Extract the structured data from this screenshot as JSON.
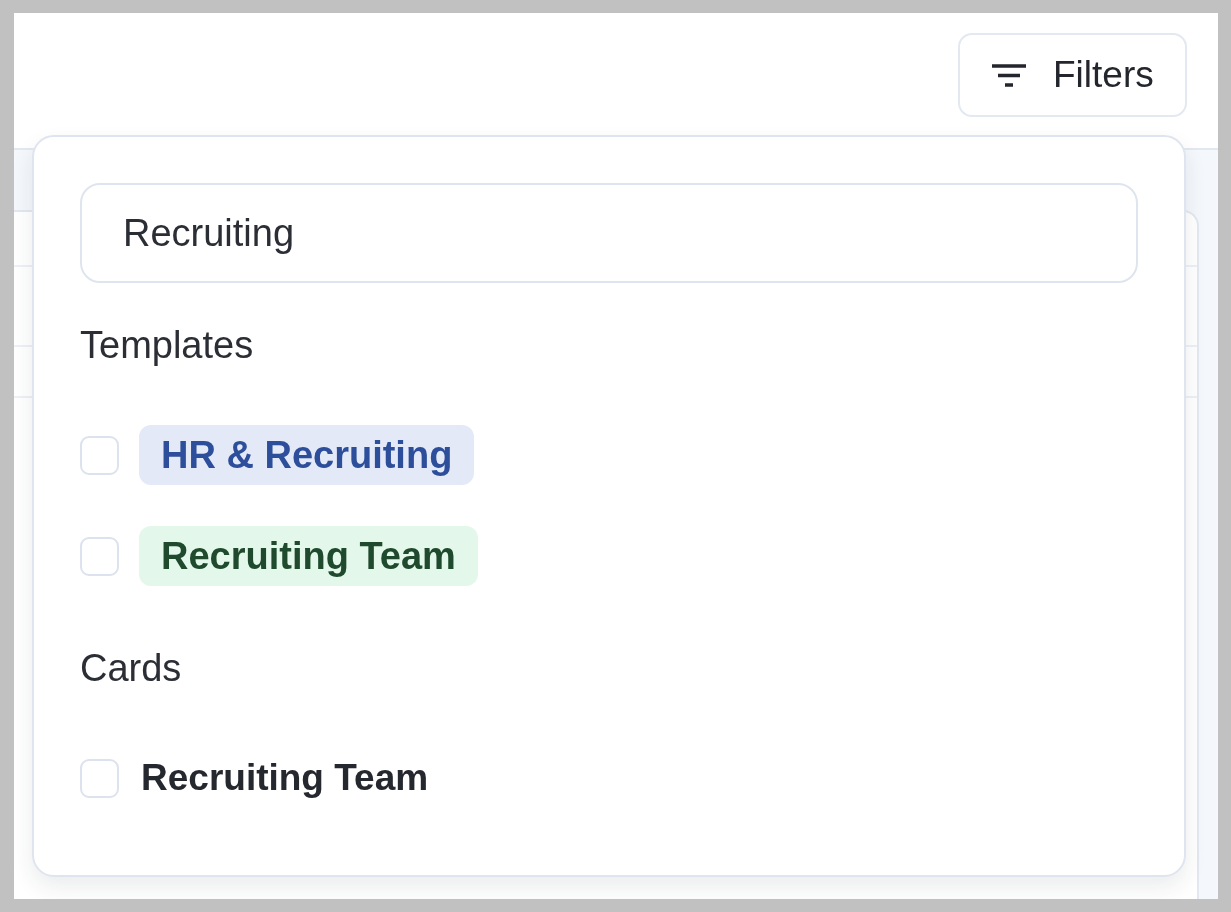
{
  "header": {
    "filters_button": {
      "label": "Filters"
    }
  },
  "filter_popover": {
    "search": {
      "value": "Recruiting"
    },
    "sections": [
      {
        "title": "Templates",
        "items": [
          {
            "kind": "tag",
            "label": "HR & Recruiting",
            "checked": false,
            "color": "#2d4e9a"
          },
          {
            "kind": "tag",
            "label": "Recruiting Team",
            "checked": false,
            "color": "#1f4a2e"
          }
        ]
      },
      {
        "title": "Cards",
        "items": [
          {
            "kind": "plain",
            "label": "Recruiting Team",
            "checked": false
          }
        ]
      }
    ]
  }
}
